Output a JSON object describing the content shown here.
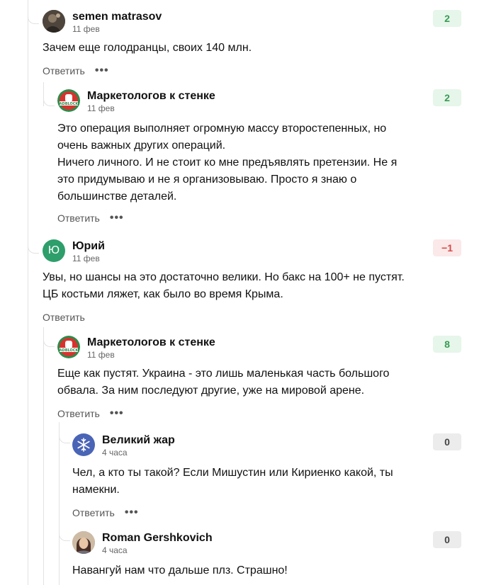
{
  "ui": {
    "reply_label": "Ответить",
    "more_glyph": "•••"
  },
  "colors": {
    "score_positive_bg": "#e6f6ea",
    "score_positive_text": "#3a9a55",
    "score_negative_bg": "#fbe8e8",
    "score_negative_text": "#d34a4a",
    "score_zero_bg": "#ececec",
    "avatar_yuriy_bg": "#2e9e6b",
    "avatar_zhar_bg": "#4a64b6"
  },
  "comments": [
    {
      "author": "semen matrasov",
      "date": "11 фев",
      "score": "2",
      "avatar_icon": "photo-avatar",
      "text": [
        "Зачем еще голодранцы, своих 140 млн."
      ]
    },
    {
      "author": "Маркетологов к стенке",
      "date": "11 фев",
      "score": "2",
      "avatar_icon": "adblock-stop-hand-icon",
      "avatar_text": "ADBLOCK",
      "text": [
        "Это операция выполняет огромную массу второстепенных, но",
        "очень важных других операций.",
        "Ничего личного. И не стоит ко мне предъявлять претензии. Не я",
        "это придумываю и не я организовываю. Просто я знаю о",
        "большинстве деталей."
      ]
    },
    {
      "author": "Юрий",
      "date": "11 фев",
      "score": "−1",
      "avatar_letter": "Ю",
      "text": [
        "Увы, но шансы на это достаточно велики. Но бакс на 100+ не пустят.",
        "ЦБ костьми ляжет, как было во время Крыма."
      ]
    },
    {
      "author": "Маркетологов к стенке",
      "date": "11 фев",
      "score": "8",
      "avatar_icon": "adblock-stop-hand-icon",
      "avatar_text": "ADBLOCK",
      "text": [
        "Еще как пустят. Украина - это лишь маленькая часть большого",
        "обвала. За ним последуют другие, уже на мировой арене."
      ]
    },
    {
      "author": "Великий жар",
      "date": "4 часа",
      "score": "0",
      "avatar_icon": "snowflake-icon",
      "text": [
        "Чел, а кто ты такой? Если Мишустин или Кириенко какой, ты",
        "намекни."
      ]
    },
    {
      "author": "Roman Gershkovich",
      "date": "4 часа",
      "score": "0",
      "avatar_icon": "photo-avatar",
      "text": [
        "Навангуй нам что дальше плз. Страшно!"
      ]
    }
  ]
}
